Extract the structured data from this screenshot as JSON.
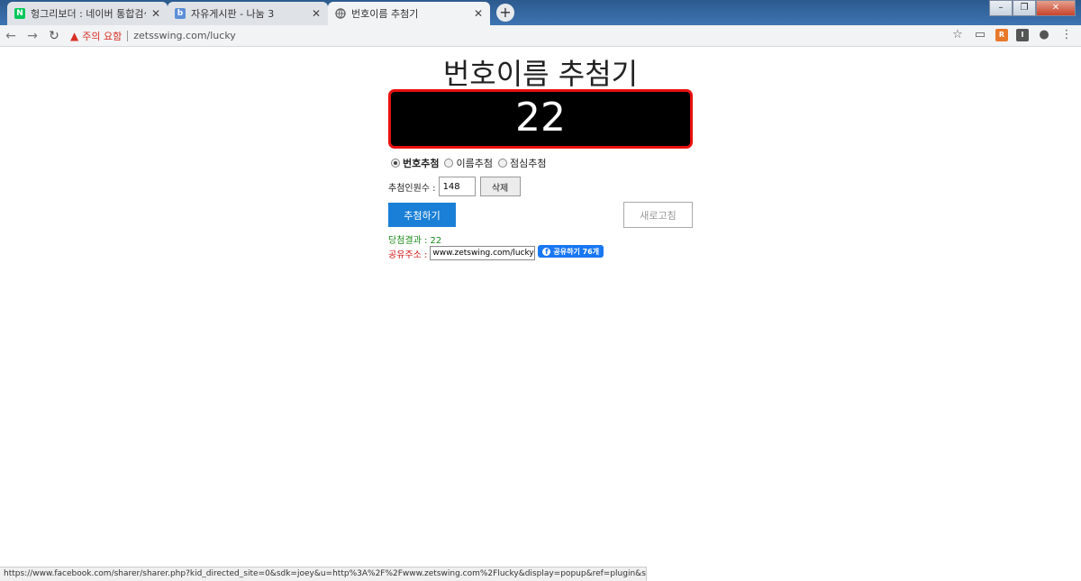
{
  "browser": {
    "tabs": [
      {
        "title": "헝그리보더 : 네이버 통합검색",
        "favicon": "N",
        "favicon_color": "#03c75a",
        "active": false
      },
      {
        "title": "자유게시판 - 나눔 3",
        "favicon": "b",
        "favicon_color": "#5c8fd6",
        "active": false
      },
      {
        "title": "번호이름 추첨기",
        "favicon": "globe-icon",
        "favicon_color": "#666666",
        "active": true
      }
    ],
    "close_glyph": "✕",
    "new_tab_glyph": "+",
    "security_warning": "주의 요함",
    "url": "zetsswing.com/lucky",
    "status_url": "https://www.facebook.com/sharer/sharer.php?kid_directed_site=0&sdk=joey&u=http%3A%2F%2Fwww.zetswing.com%2Flucky&display=popup&ref=plugin&src=share_button"
  },
  "page": {
    "title": "번호이름 추첨기",
    "drawn_number": "22",
    "modes": [
      {
        "label": "번호추첨",
        "selected": true
      },
      {
        "label": "이름추첨",
        "selected": false
      },
      {
        "label": "점심추첨",
        "selected": false
      }
    ],
    "count_label": "추첨인원수 :",
    "count_value": "148",
    "delete_label": "삭제",
    "draw_label": "추첨하기",
    "refresh_label": "새로고침",
    "result_text": "당첨결과 : 22",
    "share_label": "공유주소 :",
    "share_url": "www.zetswing.com/lucky",
    "fb_share_label": "공유하기 76개"
  },
  "colors": {
    "display_border": "#e81010",
    "draw_button": "#1a7fd6",
    "result_text": "#1a8a1a",
    "share_label": "#d01010",
    "facebook_blue": "#1877f2"
  }
}
